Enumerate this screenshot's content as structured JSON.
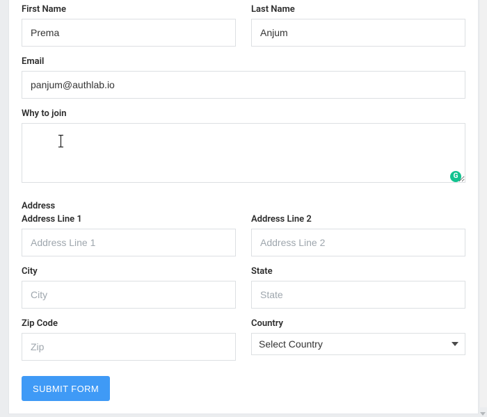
{
  "form": {
    "firstName": {
      "label": "First Name",
      "value": "Prema"
    },
    "lastName": {
      "label": "Last Name",
      "value": "Anjum"
    },
    "email": {
      "label": "Email",
      "value": "panjum@authlab.io"
    },
    "whyJoin": {
      "label": "Why to join",
      "value": ""
    },
    "address": {
      "sectionLabel": "Address",
      "line1": {
        "label": "Address Line 1",
        "placeholder": "Address Line 1",
        "value": ""
      },
      "line2": {
        "label": "Address Line 2",
        "placeholder": "Address Line 2",
        "value": ""
      },
      "city": {
        "label": "City",
        "placeholder": "City",
        "value": ""
      },
      "state": {
        "label": "State",
        "placeholder": "State",
        "value": ""
      },
      "zip": {
        "label": "Zip Code",
        "placeholder": "Zip",
        "value": ""
      },
      "country": {
        "label": "Country",
        "selected": "Select Country"
      }
    },
    "submitLabel": "SUBMIT FORM"
  },
  "grammarlyBadge": "G"
}
